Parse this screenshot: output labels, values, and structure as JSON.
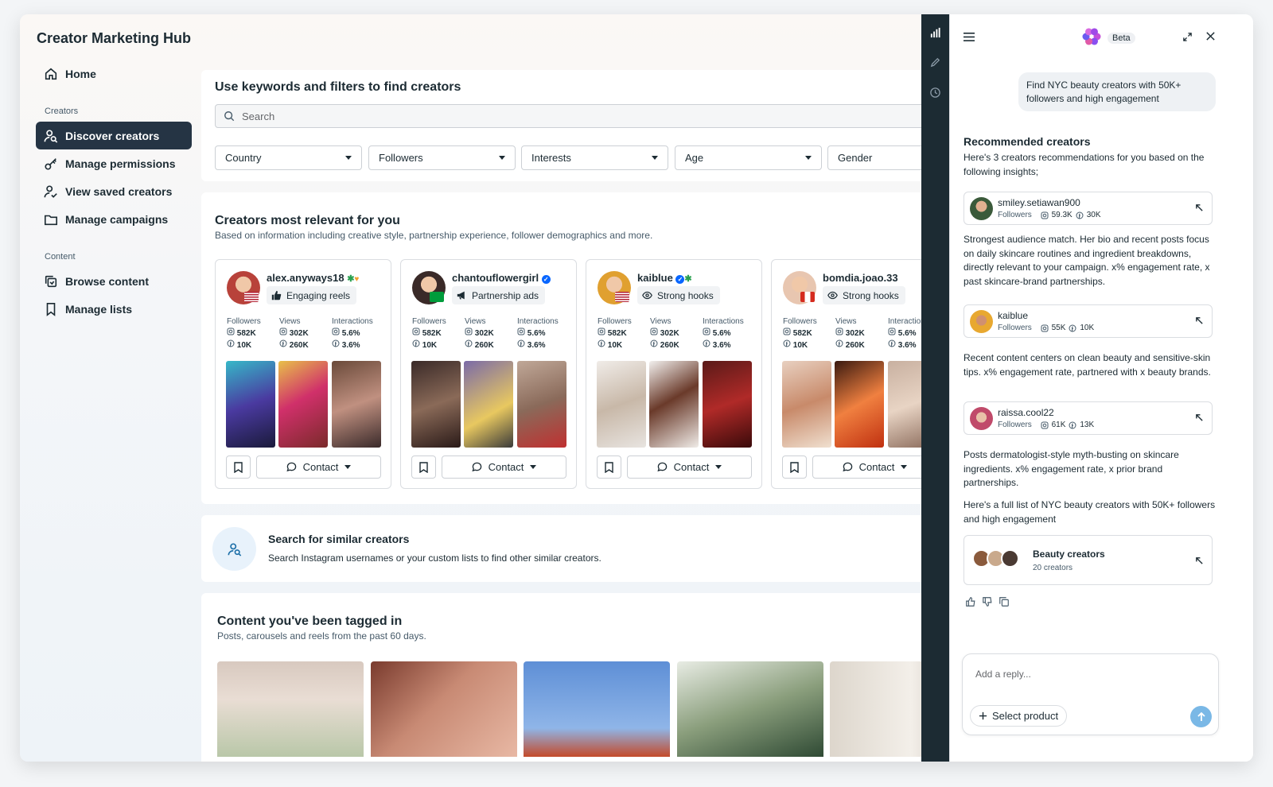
{
  "app": {
    "title": "Creator Marketing Hub"
  },
  "sidebar": {
    "home": "Home",
    "section_creators": "Creators",
    "section_content": "Content",
    "items": [
      {
        "label": "Discover creators"
      },
      {
        "label": "Manage permissions"
      },
      {
        "label": "View saved creators"
      },
      {
        "label": "Manage campaigns"
      },
      {
        "label": "Browse content"
      },
      {
        "label": "Manage lists"
      }
    ]
  },
  "search_card": {
    "title": "Use keywords and filters to find creators",
    "placeholder": "Search",
    "filters": [
      "Country",
      "Followers",
      "Interests",
      "Age",
      "Gender"
    ]
  },
  "relevant": {
    "title": "Creators most relevant for you",
    "subtitle": "Based on information including creative style, partnership experience, follower demographics and more.",
    "stat_labels": {
      "followers": "Followers",
      "views": "Views",
      "interactions": "Interactions"
    },
    "contact_label": "Contact",
    "creators": [
      {
        "name": "alex.anyways18",
        "tag": "Engaging reels",
        "followers_ig": "582K",
        "followers_fb": "10K",
        "views_ig": "302K",
        "views_fb": "260K",
        "inter_ig": "5.6%",
        "inter_fb": "3.6%"
      },
      {
        "name": "chantouflowergirl",
        "tag": "Partnership ads",
        "followers_ig": "582K",
        "followers_fb": "10K",
        "views_ig": "302K",
        "views_fb": "260K",
        "inter_ig": "5.6%",
        "inter_fb": "3.6%"
      },
      {
        "name": "kaiblue",
        "tag": "Strong hooks",
        "followers_ig": "582K",
        "followers_fb": "10K",
        "views_ig": "302K",
        "views_fb": "260K",
        "inter_ig": "5.6%",
        "inter_fb": "3.6%"
      },
      {
        "name": "bomdia.joao.33",
        "tag": "Strong hooks",
        "followers_ig": "582K",
        "followers_fb": "10K",
        "views_ig": "302K",
        "views_fb": "260K",
        "inter_ig": "5.6%",
        "inter_fb": "3.6%"
      }
    ]
  },
  "similar": {
    "title": "Search for similar creators",
    "subtitle": "Search Instagram usernames or your custom lists to find other similar creators."
  },
  "tagged": {
    "title": "Content you've been tagged in",
    "subtitle": "Posts, carousels and reels from the past 60 days."
  },
  "chat": {
    "badge": "Beta",
    "user_message": "Find NYC beauty creators with 50K+ followers and high engagement",
    "heading": "Recommended creators",
    "intro": "Here's 3 creators recommendations for you based on the following insights;",
    "followers_label": "Followers",
    "recommendations": [
      {
        "name": "smiley.setiawan900",
        "ig": "59.3K",
        "fb": "30K",
        "text": "Strongest audience match. Her bio and recent posts focus on daily skincare routines and ingredient breakdowns, directly relevant to your campaign. x% engagement rate, x past skincare-brand partnerships."
      },
      {
        "name": "kaiblue",
        "ig": "55K",
        "fb": "10K",
        "text": "Recent content centers on clean beauty and sensitive-skin tips. x% engagement rate, partnered with x beauty brands."
      },
      {
        "name": "raissa.cool22",
        "ig": "61K",
        "fb": "13K",
        "text": "Posts dermatologist-style myth-busting on skincare ingredients. x% engagement rate, x prior brand partnerships."
      }
    ],
    "full_list_text": "Here's a full list of NYC beauty creators with 50K+ followers and high engagement",
    "list": {
      "name": "Beauty creators",
      "count": "20 creators"
    },
    "reply_placeholder": "Add a reply...",
    "select_product": "Select product"
  },
  "colors": {
    "active_nav": "#253444",
    "accent": "#0866ff",
    "rail": "#1c2b33",
    "send": "#7ab8e6"
  }
}
